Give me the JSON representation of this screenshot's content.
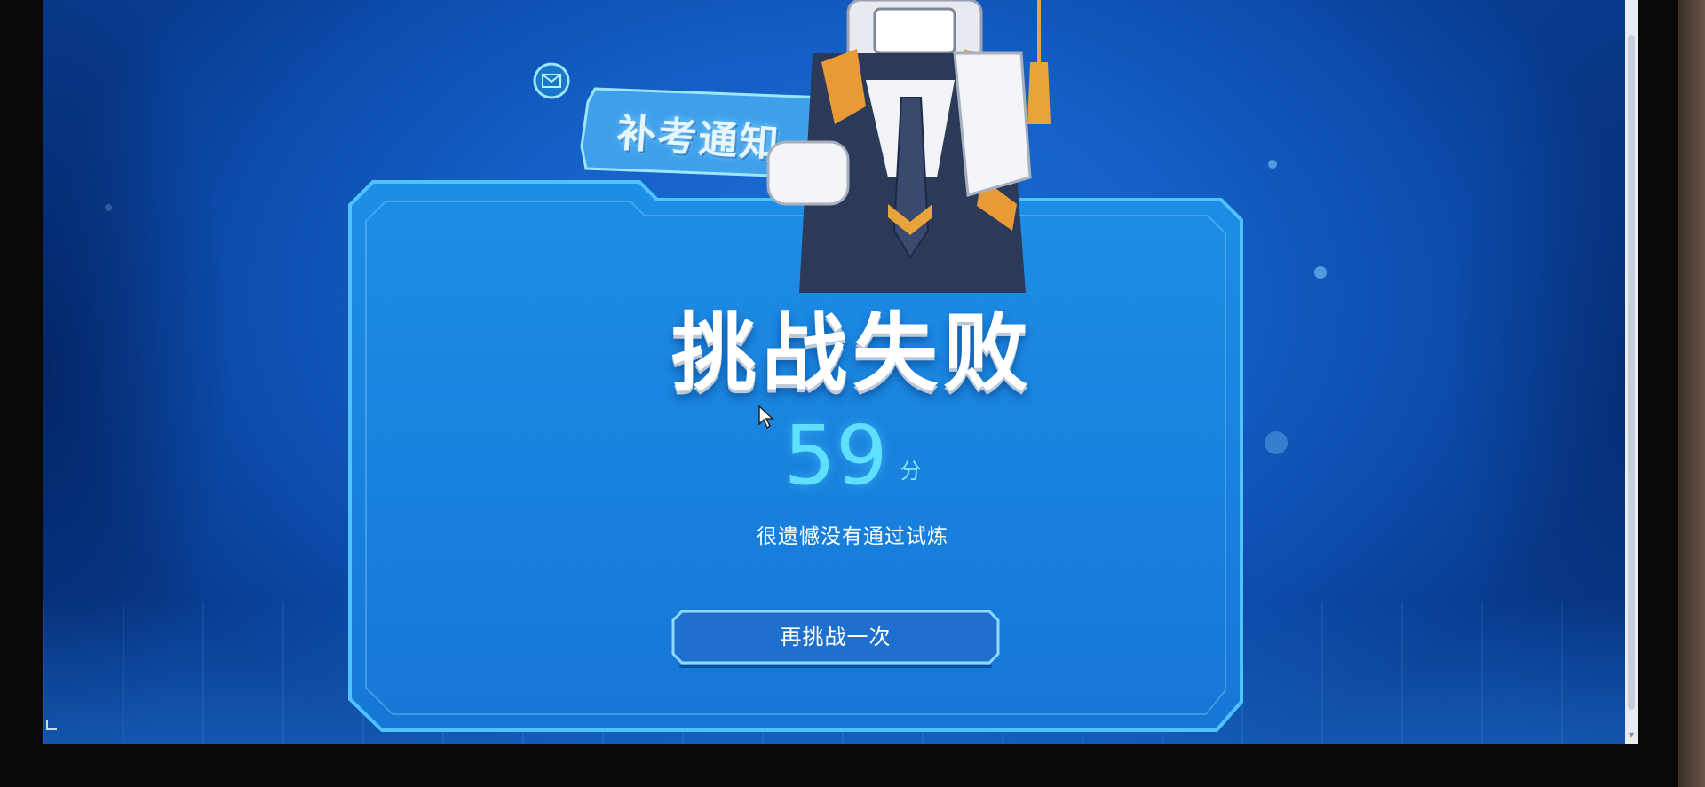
{
  "notice": {
    "label": "补考通知",
    "icon": "mail-icon"
  },
  "result": {
    "title": "挑战失败",
    "score": "59",
    "unit": "分",
    "message": "很遗憾没有通过试炼"
  },
  "actions": {
    "retry_label": "再挑战一次"
  },
  "colors": {
    "background": "#1560c7",
    "panel_border": "#3bb4ff",
    "score": "#5fe0ff",
    "button_fill": "#1d6fd0"
  }
}
